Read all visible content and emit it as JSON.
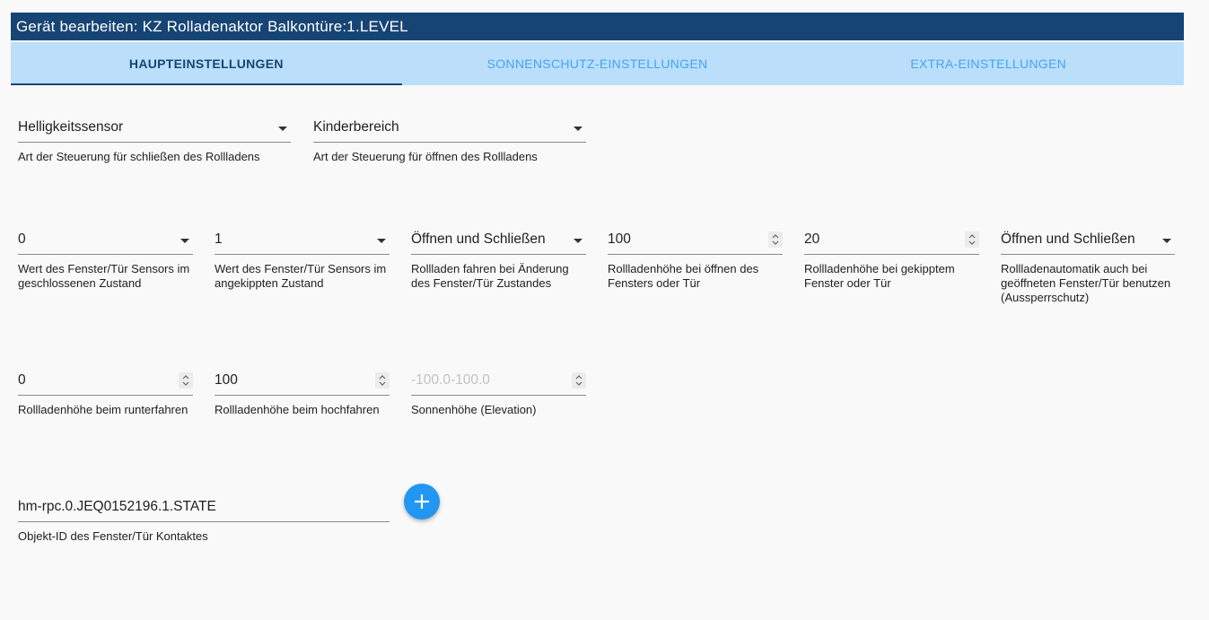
{
  "dialog": {
    "title": "Gerät bearbeiten: KZ Rolladenaktor Balkontüre:1.LEVEL"
  },
  "tabs": [
    {
      "label": "HAUPTEINSTELLUNGEN",
      "active": true
    },
    {
      "label": "SONNENSCHUTZ-EINSTELLUNGEN",
      "active": false
    },
    {
      "label": "EXTRA-EINSTELLUNGEN",
      "active": false
    }
  ],
  "row1": {
    "close_control": {
      "value": "Helligkeitssensor",
      "help": "Art der Steuerung für schließen des Rollladens"
    },
    "open_control": {
      "value": "Kinderbereich",
      "help": "Art der Steuerung für öffnen des Rollladens"
    }
  },
  "row2": {
    "sensor_closed": {
      "value": "0",
      "help": "Wert des Fenster/Tür Sensors im geschlossenen Zustand"
    },
    "sensor_tilted": {
      "value": "1",
      "help": "Wert des Fenster/Tür Sensors im angekippten Zustand"
    },
    "move_on_change": {
      "value": "Öffnen und Schließen",
      "help": "Rollladen fahren bei Änderung des Fenster/Tür Zustandes"
    },
    "height_open": {
      "value": "100",
      "help": "Rollladenhöhe bei öffnen des Fensters oder Tür"
    },
    "height_tilted": {
      "value": "20",
      "help": "Rollladenhöhe bei gekipptem Fenster oder Tür"
    },
    "lockout_protection": {
      "value": "Öffnen und Schließen",
      "help": "Rollladenautomatik auch bei geöffneten Fenster/Tür benutzen (Aussperrschutz)"
    }
  },
  "row3": {
    "height_down": {
      "value": "0",
      "help": "Rollladenhöhe beim runterfahren"
    },
    "height_up": {
      "value": "100",
      "help": "Rollladenhöhe beim hochfahren"
    },
    "sun_elevation": {
      "value": "",
      "placeholder": "-100.0-100.0",
      "help": "Sonnenhöhe (Elevation)"
    }
  },
  "row4": {
    "object_id": {
      "value": "hm-rpc.0.JEQ0152196.1.STATE",
      "help": "Objekt-ID des Fenster/Tür Kontaktes"
    }
  },
  "colors": {
    "title_bg": "#164575",
    "tabs_bg": "#bbdefb",
    "tab_inactive": "#42a5f5",
    "fab": "#2196f3"
  },
  "icons": {
    "dropdown": "chevron-down-icon",
    "stepper": "spin-arrows-icon",
    "add": "plus-icon"
  }
}
